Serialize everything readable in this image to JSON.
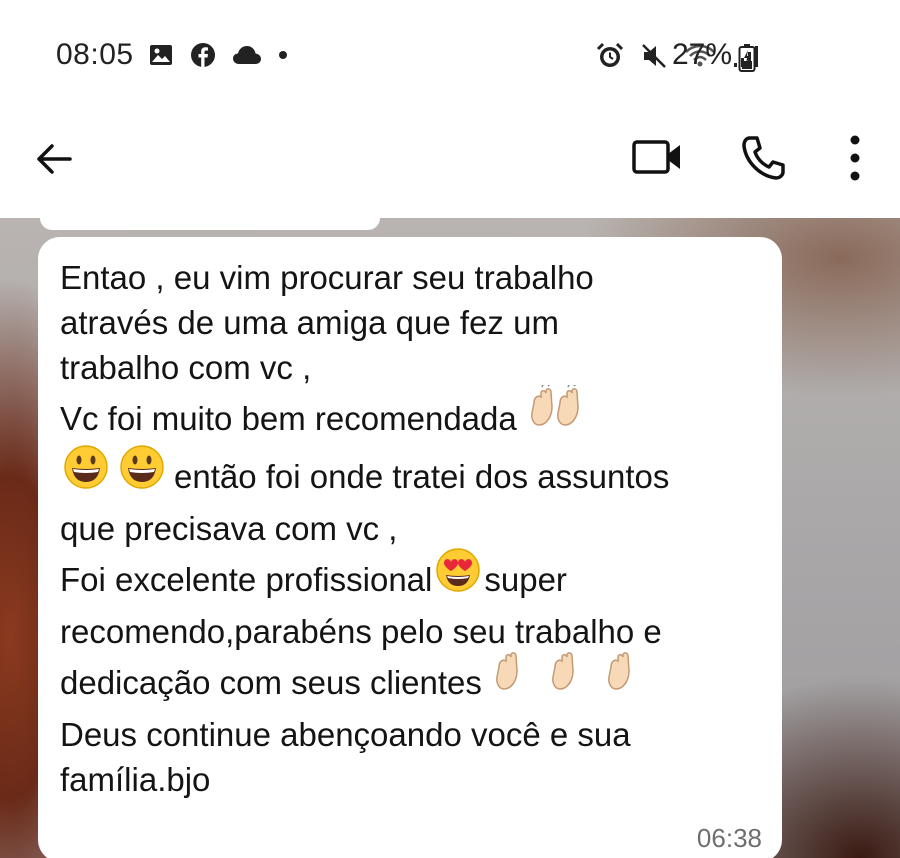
{
  "status_bar": {
    "time": "08:05",
    "battery": "27%",
    "icons": [
      "gallery-icon",
      "facebook-icon",
      "cloud-icon",
      "dot-icon",
      "alarm-icon",
      "mute-icon",
      "wifi-icon",
      "signal-icon",
      "battery-icon"
    ]
  },
  "top_bar": {
    "icons": [
      "back-arrow-icon",
      "video-call-icon",
      "phone-icon",
      "more-vert-icon"
    ]
  },
  "message": {
    "lines": [
      "Entao , eu vim procurar seu trabalho",
      "através de uma amiga que fez um",
      "trabalho com vc ,",
      "Vc foi muito bem recomendada",
      "então foi onde tratei dos assuntos",
      "que precisava com vc ,",
      "Foi excelente profissional",
      "super",
      "recomendo,parabéns pelo seu trabalho e",
      "dedicação com seus clientes",
      "Deus continue abençoando você e sua",
      "família.bjo"
    ],
    "time": "06:38",
    "emojis": [
      "clapping-hands",
      "grinning-face",
      "heart-eyes-face"
    ]
  },
  "colors": {
    "bubble": "#ffffff",
    "text": "#141414",
    "timestamp": "#6f6f6f"
  }
}
